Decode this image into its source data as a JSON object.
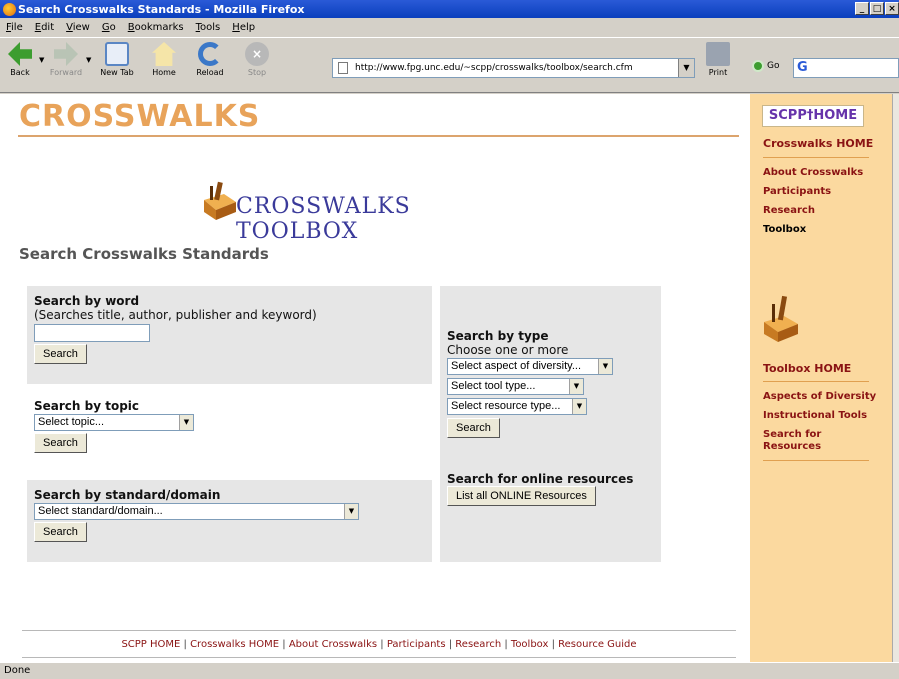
{
  "window": {
    "title": "Search Crosswalks Standards - Mozilla Firefox"
  },
  "menu": [
    "File",
    "Edit",
    "View",
    "Go",
    "Bookmarks",
    "Tools",
    "Help"
  ],
  "toolbar": {
    "back": "Back",
    "forward": "Forward",
    "new_tab": "New Tab",
    "home": "Home",
    "reload": "Reload",
    "stop": "Stop",
    "print": "Print",
    "go": "Go",
    "url": "http://www.fpg.unc.edu/~scpp/crosswalks/toolbox/search.cfm"
  },
  "page": {
    "logo": "CROSSWALKS",
    "toolbox_title": "CROSSWALKS TOOLBOX",
    "heading": "Search Crosswalks Standards"
  },
  "search_word": {
    "label": "Search by word",
    "hint": "(Searches title, author, publisher and keyword)",
    "value": "",
    "button": "Search"
  },
  "search_topic": {
    "label": "Search by topic",
    "select": "Select topic...",
    "button": "Search"
  },
  "search_standard": {
    "label": "Search by standard/domain",
    "select": "Select standard/domain...",
    "button": "Search"
  },
  "search_type": {
    "label": "Search by type",
    "sub": "Choose one or more",
    "select_diversity": "Select aspect of diversity...",
    "select_tool": "Select tool type...",
    "select_resource": "Select resource type...",
    "button": "Search"
  },
  "online": {
    "label": "Search for online resources",
    "button": "List all ONLINE Resources"
  },
  "footer": {
    "links": [
      "SCPP HOME",
      "Crosswalks HOME",
      "About Crosswalks",
      "Participants",
      "Research",
      "Toolbox",
      "Resource Guide"
    ],
    "separator": " | "
  },
  "sidebar": {
    "scpp_home": "SCPP†HOME",
    "crosswalks_home": "Crosswalks HOME",
    "about": "About Crosswalks",
    "participants": "Participants",
    "research": "Research",
    "toolbox": "Toolbox",
    "toolbox_home": "Toolbox HOME",
    "aspects": "Aspects of Diversity",
    "instructional": "Instructional Tools",
    "search_resources": "Search for Resources"
  },
  "status": "Done"
}
